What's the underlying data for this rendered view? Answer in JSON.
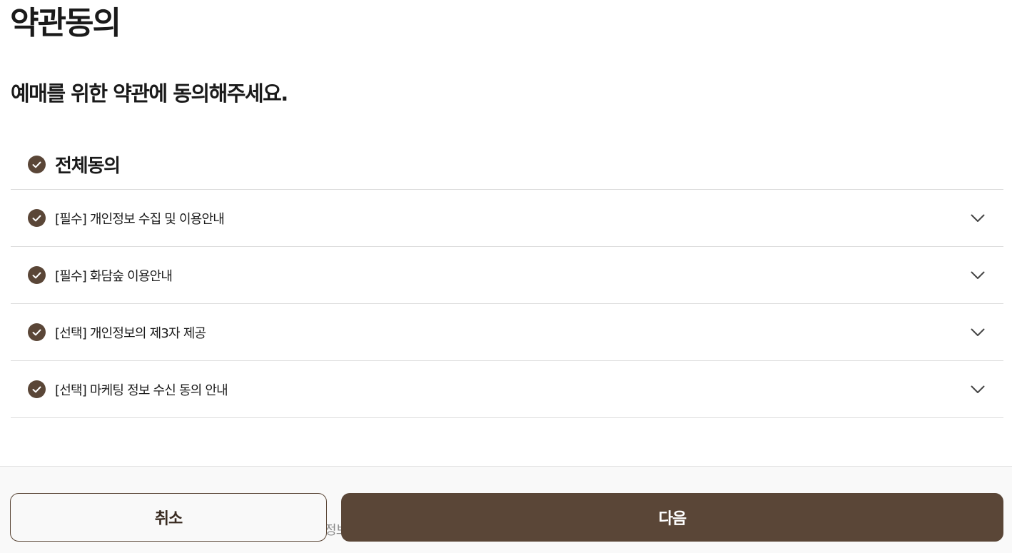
{
  "header": {
    "title": "약관동의",
    "subtitle": "예매를 위한 약관에 동의해주세요."
  },
  "agreements": {
    "all_label": "전체동의",
    "all_checked": true,
    "items": [
      {
        "label": "[필수] 개인정보 수집 및 이용안내",
        "checked": true,
        "icon": "chevron-down-icon"
      },
      {
        "label": "[필수] 화담숲 이용안내",
        "checked": true,
        "icon": "chevron-down-icon"
      },
      {
        "label": "[선택] 개인정보의 제3자 제공",
        "checked": true,
        "icon": "chevron-down-icon"
      },
      {
        "label": "[선택] 마케팅 정보 수신 동의 안내",
        "checked": true,
        "icon": "chevron-down-icon"
      }
    ]
  },
  "footer": {
    "peek_text": "정보",
    "cancel_label": "취소",
    "next_label": "다음"
  },
  "colors": {
    "accent": "#5a4637",
    "divider": "#dcdcdc",
    "footer_bg": "#f9f9f9"
  }
}
